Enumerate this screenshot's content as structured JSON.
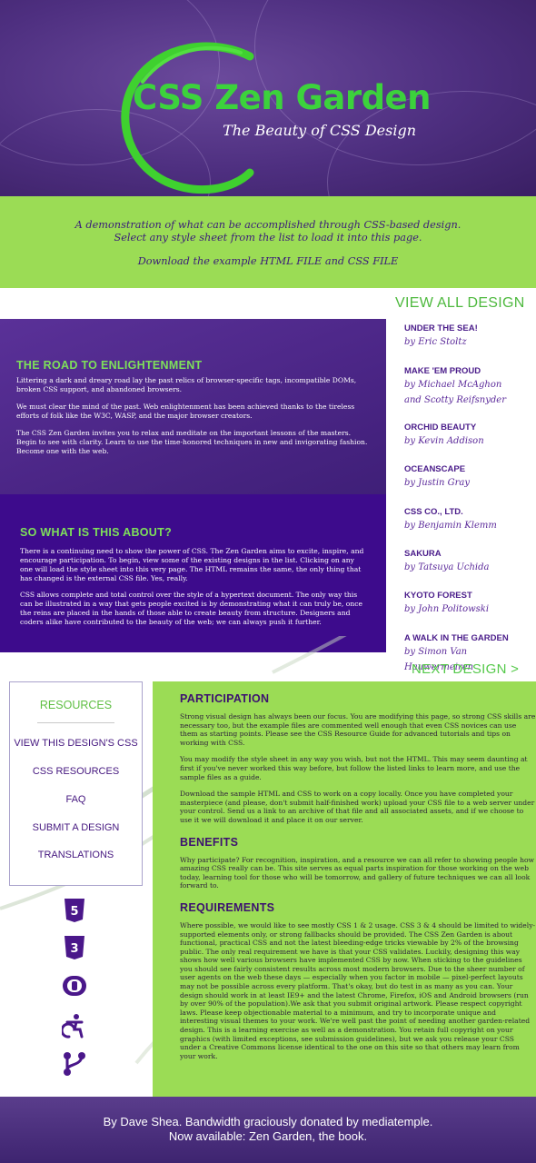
{
  "header": {
    "title": "CSS Zen Garden",
    "tagline": "The Beauty of CSS Design"
  },
  "intro": {
    "summary_line1": "A demonstration of what can be accomplished through CSS-based design.",
    "summary_line2": "Select any style sheet from the list to load it into this page.",
    "download_text": "Download the example HTML FILE and CSS FILE"
  },
  "road": {
    "title": "THE ROAD TO ENLIGHTENMENT",
    "p1": "Littering a dark and dreary road lay the past relics of browser-specific tags, incompatible DOMs, broken CSS support, and abandoned browsers.",
    "p2": "We must clear the mind of the past. Web enlightenment has been achieved thanks to the tireless efforts of folk like the W3C, WASP, and the major browser creators.",
    "p3": "The CSS Zen Garden invites you to relax and meditate on the important lessons of the masters. Begin to see with clarity. Learn to use the time-honored techniques in new and invigorating fashion. Become one with the web."
  },
  "about": {
    "title": "SO WHAT IS THIS ABOUT?",
    "p1": "There is a continuing need to show the power of CSS. The Zen Garden aims to excite, inspire, and encourage participation. To begin, view some of the existing designs in the list. Clicking on any one will load the style sheet into this very page. The HTML remains the same, the only thing that has changed is the external CSS file. Yes, really.",
    "p2": "CSS allows complete and total control over the style of a hypertext document. The only way this can be illustrated in a way that gets people excited is by demonstrating what it can truly be, once the reins are placed in the hands of those able to create beauty from structure. Designers and coders alike have contributed to the beauty of the web; we can always push it further."
  },
  "designs": {
    "view_all": "VIEW ALL DESIGN",
    "next": "NEXT DESIGN >",
    "items": [
      {
        "name": "UNDER THE SEA!",
        "by": "by Eric Stoltz"
      },
      {
        "name": "MAKE 'EM PROUD",
        "by": "by Michael McAghon",
        "by2": "and Scotty Reifsnyder"
      },
      {
        "name": "ORCHID BEAUTY",
        "by": "by Kevin Addison"
      },
      {
        "name": "OCEANSCAPE",
        "by": "by Justin Gray"
      },
      {
        "name": "CSS CO., LTD.",
        "by": "by Benjamin Klemm"
      },
      {
        "name": "SAKURA",
        "by": "by Tatsuya Uchida"
      },
      {
        "name": "KYOTO FOREST",
        "by": "by John Politowski"
      },
      {
        "name": "A WALK IN THE GARDEN",
        "by": "by Simon Van Hauwermeiren"
      }
    ]
  },
  "resources": {
    "title": "RESOURCES",
    "links": [
      "VIEW THIS DESIGN'S CSS",
      "CSS RESOURCES",
      "FAQ",
      "SUBMIT A DESIGN",
      "TRANSLATIONS"
    ]
  },
  "participation": {
    "title": "PARTICIPATION",
    "p1": "Strong visual design has always been our focus. You are modifying this page, so strong CSS skills are necessary too, but the example files are commented well enough that even CSS novices can use them as starting points. Please see the CSS Resource Guide for advanced tutorials and tips on working with CSS.",
    "p2": "You may modify the style sheet in any way you wish, but not the HTML. This may seem daunting at first if you've never worked this way before, but follow the listed links to learn more, and use the sample files as a guide.",
    "p3": "Download the sample HTML and CSS to work on a copy locally. Once you have completed your masterpiece (and please, don't submit half-finished work) upload your CSS file to a web server under your control. Send us a link to an archive of that file and all associated assets, and if we choose to use it we will download it and place it on our server."
  },
  "benefits": {
    "title": "BENEFITS",
    "p1": "Why participate? For recognition, inspiration, and a resource we can all refer to showing people how amazing CSS really can be. This site serves as equal parts inspiration for those working on the web today, learning tool for those who will be tomorrow, and gallery of future techniques we can all look forward to."
  },
  "requirements": {
    "title": "REQUIREMENTS",
    "p1": "Where possible, we would like to see mostly CSS 1 & 2 usage. CSS 3 & 4 should be limited to widely-supported elements only, or strong fallbacks should be provided. The CSS Zen Garden is about functional, practical CSS and not the latest bleeding-edge tricks viewable by 2% of the browsing public. The only real requirement we have is that your CSS validates. Luckily, designing this way shows how well various browsers have implemented CSS by now. When sticking to the guidelines you should see fairly consistent results across most modern browsers. Due to the sheer number of user agents on the web these days — especially when you factor in mobile — pixel-perfect layouts may not be possible across every platform. That's okay, but do test in as many as you can. Your design should work in at least IE9+ and the latest Chrome, Firefox, iOS and Android browsers (run by over 90% of the population).We ask that you submit original artwork. Please respect copyright laws. Please keep objectionable material to a minimum, and try to incorporate unique and interesting visual themes to your work. We're well past the point of needing another garden-related design. This is a learning exercise as well as a demonstration. You retain full copyright on your graphics (with limited exceptions, see submission guidelines), but we ask you release your CSS under a Creative Commons license identical to the one on this site so that others may learn from your work."
  },
  "badges": [
    "html5-icon",
    "css3-icon",
    "open-web-icon",
    "accessibility-icon",
    "fork-icon"
  ],
  "footer": {
    "line1": "By Dave Shea. Bandwidth graciously donated by mediatemple.",
    "line2": "Now available: Zen Garden, the book."
  },
  "colors": {
    "brand_green": "#3cd23c",
    "light_green": "#9bdc55",
    "deep_purple": "#3d0b8c",
    "purple": "#4a2585"
  }
}
